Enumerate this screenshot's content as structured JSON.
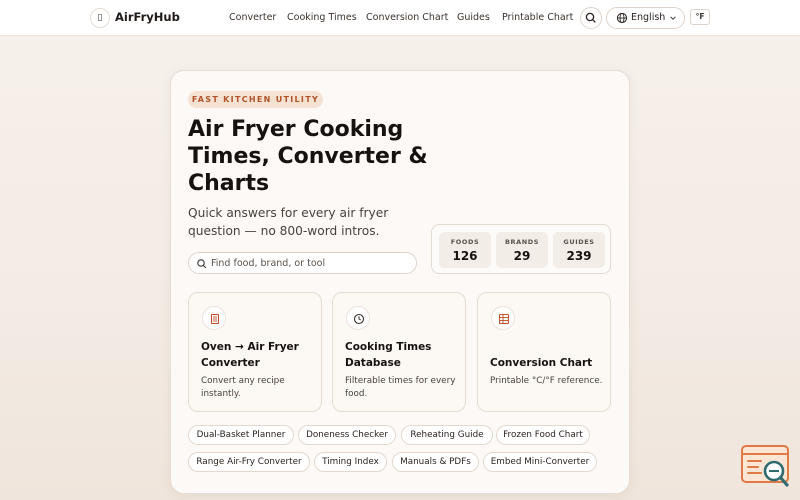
{
  "brand": {
    "logo_glyph": "▯",
    "name": "AirFryHub"
  },
  "nav": {
    "links": [
      "Converter",
      "Cooking Times",
      "Conversion Chart",
      "Guides",
      "Printable Chart"
    ],
    "language": "English",
    "unit_toggle": "°F"
  },
  "hero": {
    "eyebrow": "FAST KITCHEN UTILITY",
    "title": "Air Fryer Cooking Times, Converter & Charts",
    "subtitle": "Quick answers for every air fryer question — no 800-word intros.",
    "search_placeholder": "Find food, brand, or tool"
  },
  "stats": [
    {
      "label": "FOODS",
      "value": "126"
    },
    {
      "label": "BRANDS",
      "value": "29"
    },
    {
      "label": "GUIDES",
      "value": "239"
    }
  ],
  "features": [
    {
      "icon": "book-icon",
      "title": "Oven → Air Fryer Converter",
      "desc": "Convert any recipe instantly."
    },
    {
      "icon": "clock-icon",
      "title": "Cooking Times Database",
      "desc": "Filterable times for every food."
    },
    {
      "icon": "table-icon",
      "title": "Conversion Chart",
      "desc": "Printable °C/°F reference."
    }
  ],
  "chips_row1": [
    "Dual-Basket Planner",
    "Doneness Checker",
    "Reheating Guide",
    "Frozen Food Chart"
  ],
  "chips_row2": [
    "Range Air-Fry Converter",
    "Timing Index",
    "Manuals & PDFs",
    "Embed Mini-Converter"
  ],
  "colors": {
    "accent": "#b0532a",
    "eyebrow_bg": "#f6e2d2",
    "icon_stroke": "#c0502b",
    "widget_orange": "#e07a45",
    "widget_teal": "#2e6a6e"
  }
}
